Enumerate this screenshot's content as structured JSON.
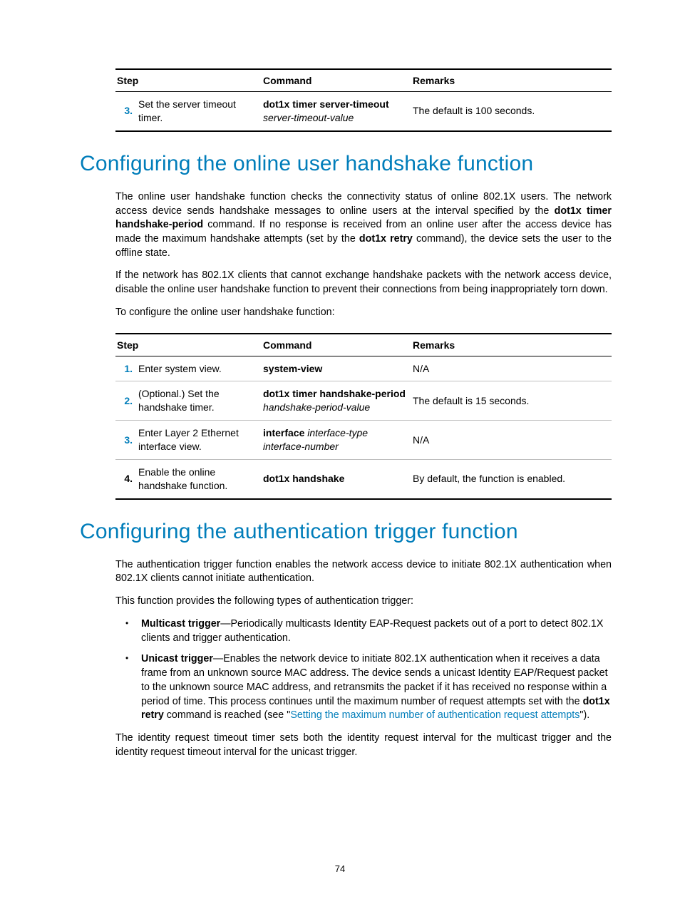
{
  "table1": {
    "headers": {
      "step": "Step",
      "command": "Command",
      "remarks": "Remarks"
    },
    "rows": [
      {
        "num": "3.",
        "num_color": "blue",
        "step": "Set the server timeout timer.",
        "cmd_bold": "dot1x timer server-timeout",
        "cmd_italic": "server-timeout-value",
        "remarks": "The default is 100 seconds."
      }
    ]
  },
  "section1": {
    "heading": "Configuring the online user handshake function",
    "para1_a": "The online user handshake function checks the connectivity status of online 802.1X users. The network access device sends handshake messages to online users at the interval specified by the ",
    "para1_b1": "dot1x timer handshake-period",
    "para1_c": " command. If no response is received from an online user after the access device has made the maximum handshake attempts (set by the ",
    "para1_b2": "dot1x retry",
    "para1_d": " command), the device sets the user to the offline state.",
    "para2": "If the network has 802.1X clients that cannot exchange handshake packets with the network access device, disable the online user handshake function to prevent their connections from being inappropriately torn down.",
    "para3": "To configure the online user handshake function:"
  },
  "table2": {
    "headers": {
      "step": "Step",
      "command": "Command",
      "remarks": "Remarks"
    },
    "rows": [
      {
        "num": "1.",
        "num_color": "blue",
        "step": "Enter system view.",
        "cmd_bold": "system-view",
        "cmd_italic": "",
        "remarks": "N/A"
      },
      {
        "num": "2.",
        "num_color": "blue",
        "step": "(Optional.) Set the handshake timer.",
        "cmd_bold": "dot1x timer handshake-period",
        "cmd_italic": "handshake-period-value",
        "remarks": "The default is 15 seconds."
      },
      {
        "num": "3.",
        "num_color": "blue",
        "step": "Enter Layer 2 Ethernet interface view.",
        "cmd_bold": "interface",
        "cmd_italic": " interface-type interface-number",
        "remarks": "N/A"
      },
      {
        "num": "4.",
        "num_color": "black",
        "step": "Enable the online handshake function.",
        "cmd_bold": "dot1x handshake",
        "cmd_italic": "",
        "remarks": "By default, the function is enabled."
      }
    ]
  },
  "section2": {
    "heading": "Configuring the authentication trigger function",
    "para1": "The authentication trigger function enables the network access device to initiate 802.1X authentication when 802.1X clients cannot initiate authentication.",
    "para2": "This function provides the following types of authentication trigger:",
    "bullets": [
      {
        "bold": "Multicast trigger",
        "rest": "—Periodically multicasts Identity EAP-Request packets out of a port to detect 802.1X clients and trigger authentication."
      },
      {
        "bold": "Unicast trigger",
        "rest_a": "—Enables the network device to initiate 802.1X authentication when it receives a data frame from an unknown source MAC address. The device sends a unicast Identity EAP/Request packet to the unknown source MAC address, and retransmits the packet if it has received no response within a period of time. This process continues until the maximum number of request attempts set with the ",
        "rest_b": "dot1x retry",
        "rest_c": " command is reached (see \"",
        "link": "Setting the maximum number of authentication request attempts",
        "rest_d": "\")."
      }
    ],
    "para3": "The identity request timeout timer sets both the identity request interval for the multicast trigger and the identity request timeout interval for the unicast trigger."
  },
  "page_number": "74"
}
